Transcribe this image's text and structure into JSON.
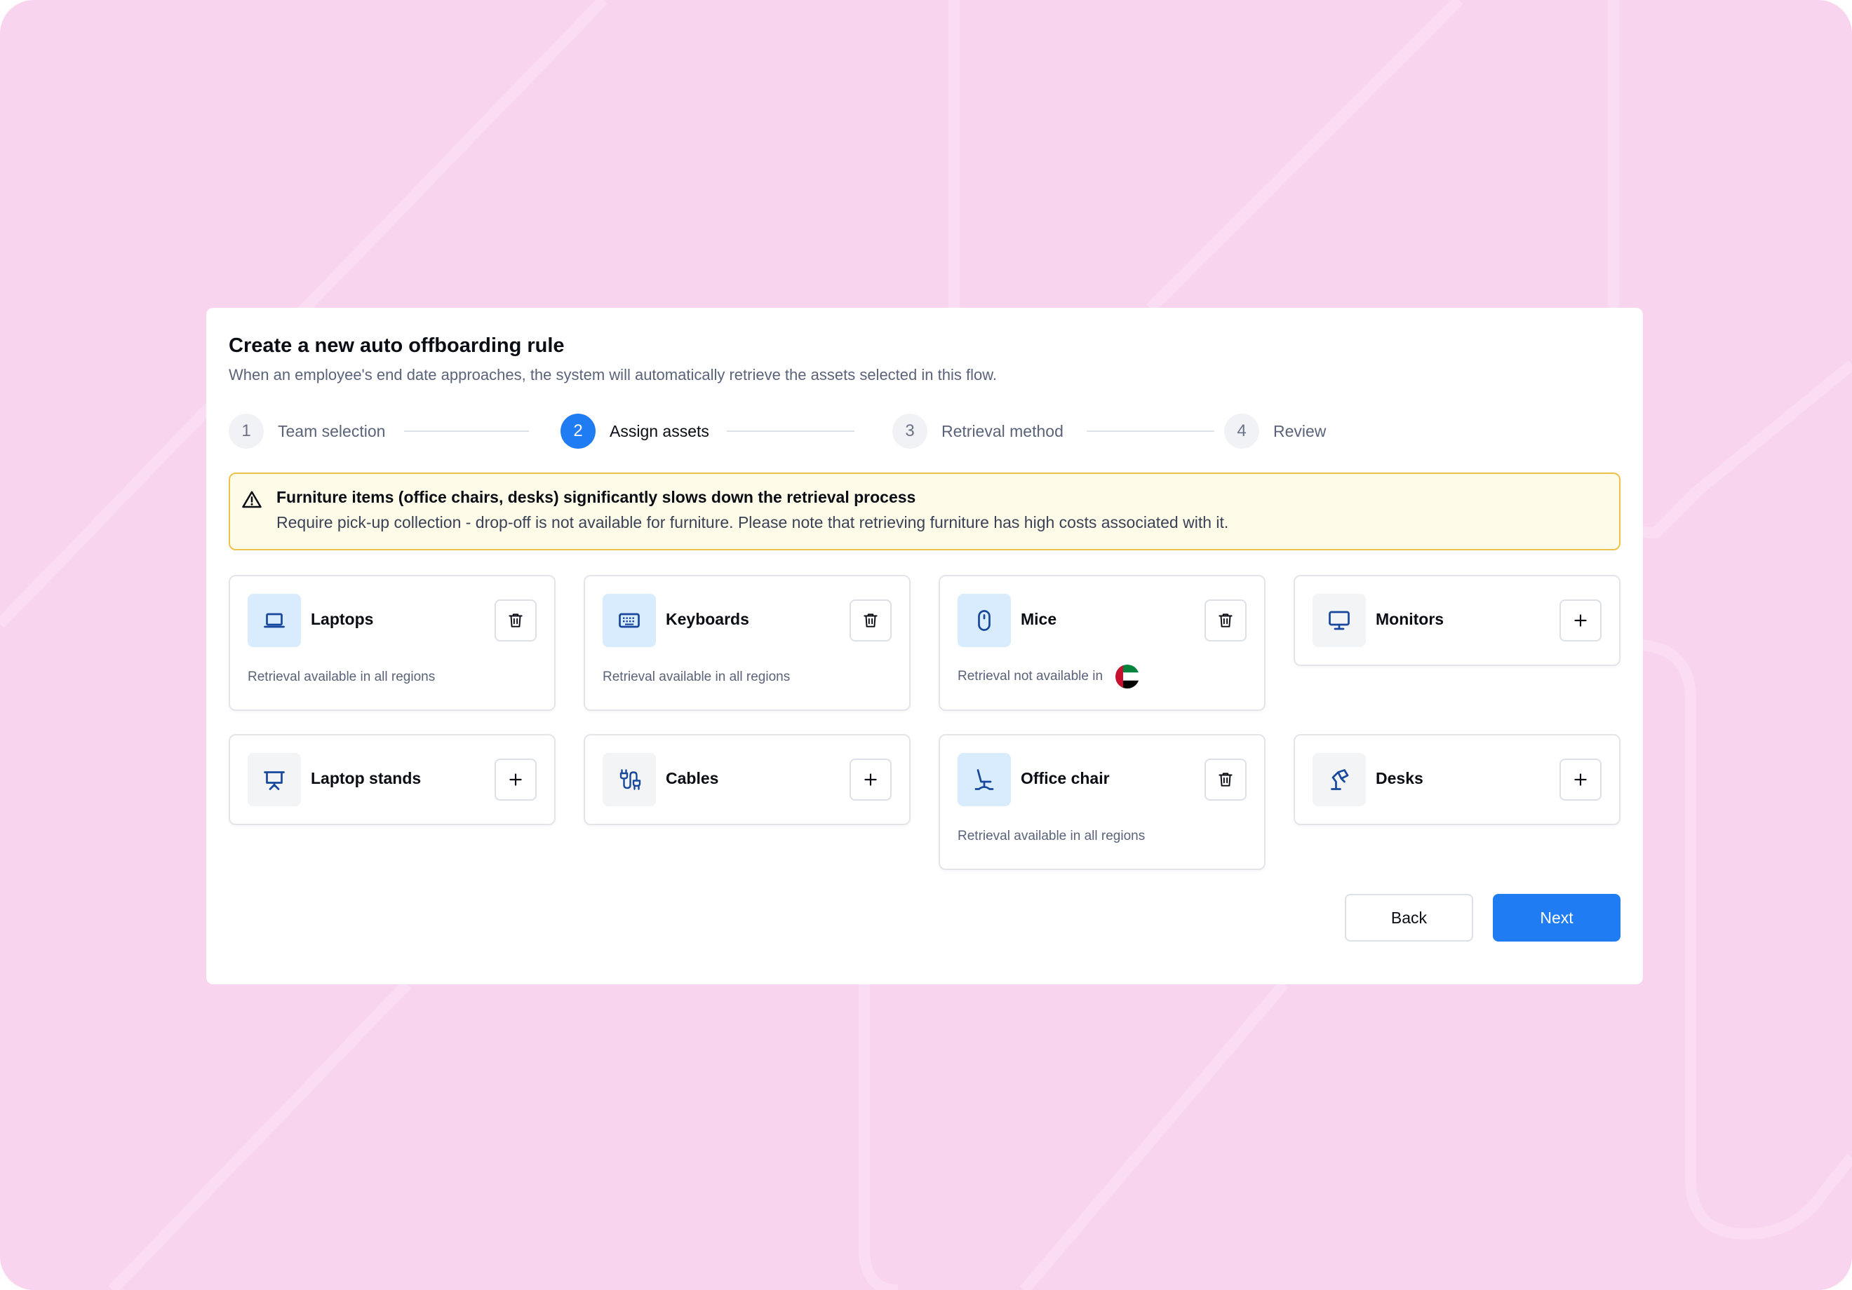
{
  "modal": {
    "title": "Create a new auto offboarding rule",
    "subtitle": "When an employee's end date approaches, the system will automatically retrieve the assets selected in this flow."
  },
  "steps": [
    {
      "number": "1",
      "label": "Team selection",
      "state": "completed"
    },
    {
      "number": "2",
      "label": "Assign assets",
      "state": "active"
    },
    {
      "number": "3",
      "label": "Retrieval method",
      "state": "upcoming"
    },
    {
      "number": "4",
      "label": "Review",
      "state": "upcoming"
    }
  ],
  "warning": {
    "icon": "alert-triangle-icon",
    "title": "Furniture items (office chairs, desks) significantly slows down the retrieval process",
    "text": "Require pick-up collection - drop-off is not available for furniture. Please note that retrieving furniture has high costs associated with it."
  },
  "assets": [
    {
      "name": "Laptops",
      "icon": "laptop-icon",
      "selected": true,
      "status": "Retrieval available in all regions"
    },
    {
      "name": "Keyboards",
      "icon": "keyboard-icon",
      "selected": true,
      "status": "Retrieval available in all regions"
    },
    {
      "name": "Mice",
      "icon": "mouse-icon",
      "selected": true,
      "status": "Retrieval not available in",
      "status_flag": "uae-flag-icon"
    },
    {
      "name": "Monitors",
      "icon": "monitor-icon",
      "selected": false
    },
    {
      "name": "Laptop stands",
      "icon": "laptop-stand-icon",
      "selected": false
    },
    {
      "name": "Cables",
      "icon": "cable-icon",
      "selected": false
    },
    {
      "name": "Office chair",
      "icon": "office-chair-icon",
      "selected": true,
      "status": "Retrieval available in all regions"
    },
    {
      "name": "Desks",
      "icon": "desk-lamp-icon",
      "selected": false
    }
  ],
  "buttons": {
    "back": "Back",
    "next": "Next"
  },
  "colors": {
    "background": "#f9d4ef",
    "primary": "#1f7cf2",
    "selected_icon_bg": "#d9ecfd",
    "warning_bg": "#fefbe8",
    "warning_border": "#ecc24a"
  }
}
